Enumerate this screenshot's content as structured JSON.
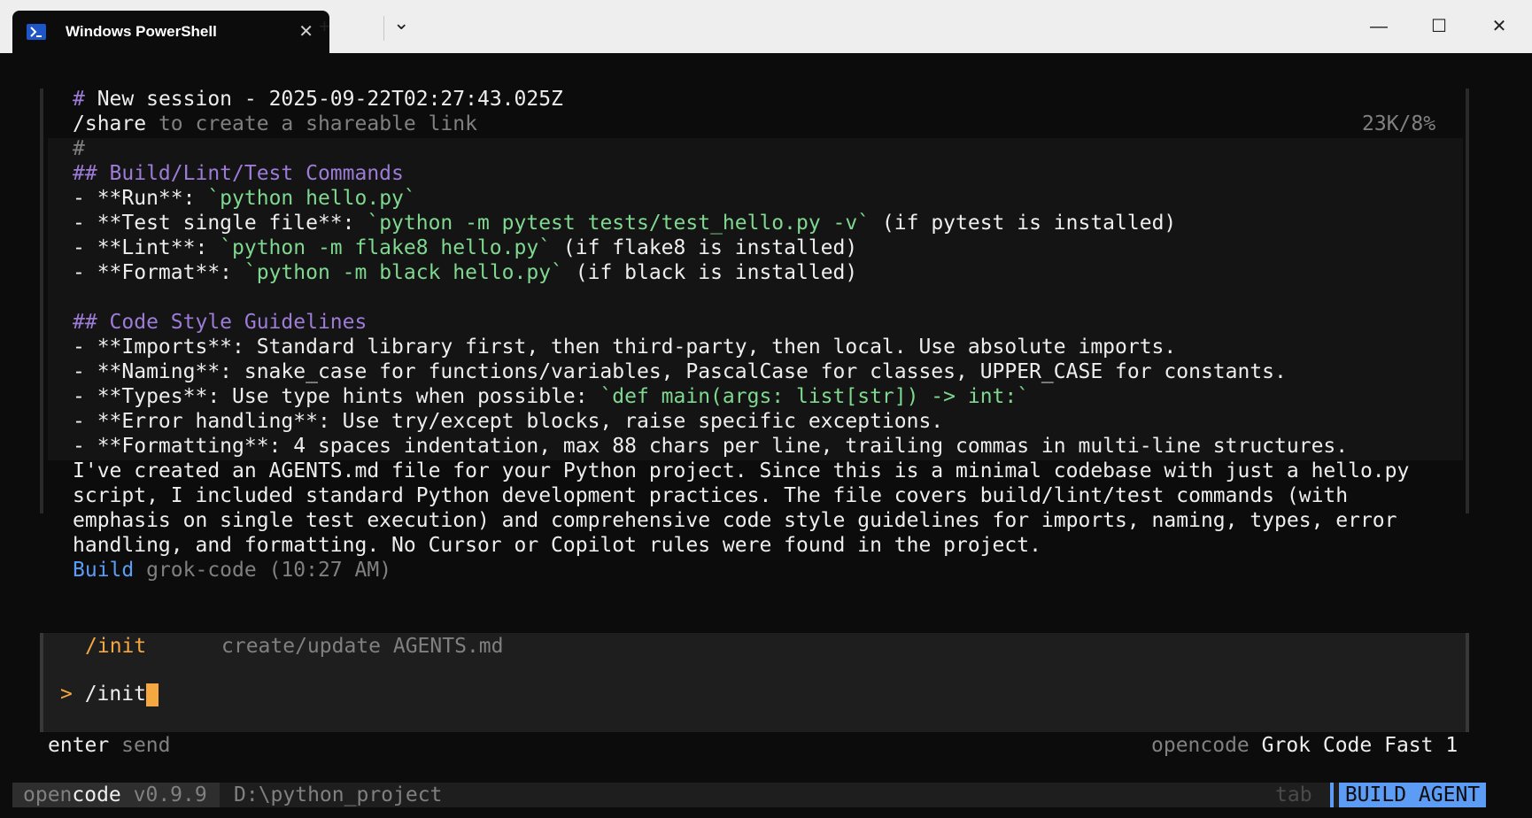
{
  "window": {
    "tab_title": "Windows PowerShell",
    "close_glyph": "✕",
    "new_tab_glyph": "+",
    "dropdown_glyph": "⌄",
    "minimize_glyph": "—",
    "maximize_glyph": "☐",
    "close_window_glyph": "✕"
  },
  "header": {
    "hash": "#",
    "title": " New session - 2025-09-22T02:27:43.025Z",
    "share_cmd": "/share",
    "share_hint": " to create a shareable link",
    "context_usage": "23K/8%"
  },
  "file_content": {
    "line0": "#",
    "line1": "## Build/Lint/Test Commands",
    "line2": [
      "- **Run**: ",
      "`python hello.py`",
      ""
    ],
    "line3": [
      "- **Test single file**: ",
      "`python -m pytest tests/test_hello.py -v`",
      " (if pytest is installed)"
    ],
    "line4": [
      "- **Lint**: ",
      "`python -m flake8 hello.py`",
      " (if flake8 is installed)"
    ],
    "line5": [
      "- **Format**: ",
      "`python -m black hello.py`",
      " (if black is installed)"
    ],
    "line6": "## Code Style Guidelines",
    "line7": "- **Imports**: Standard library first, then third-party, then local. Use absolute imports.",
    "line8": "- **Naming**: snake_case for functions/variables, PascalCase for classes, UPPER_CASE for constants.",
    "line9": [
      "- **Types**: Use type hints when possible: ",
      "`def main(args: list[str]) -> int:`"
    ],
    "line10": "- **Error handling**: Use try/except blocks, raise specific exceptions.",
    "line11": "- **Formatting**: 4 spaces indentation, max 88 chars per line, trailing commas in multi-line structures."
  },
  "response": {
    "lines": [
      "I've created an AGENTS.md file for your Python project. Since this is a minimal codebase with just a hello.py",
      "script, I included standard Python development practices. The file covers build/lint/test commands (with",
      "emphasis on single test execution) and comprehensive code style guidelines for imports, naming, types, error",
      "handling, and formatting. No Cursor or Copilot rules were found in the project."
    ],
    "agent": "Build",
    "model_time": " grok-code (10:27 AM)"
  },
  "input": {
    "suggestion_cmd": "/init",
    "suggestion_desc": "create/update AGENTS.md",
    "prompt": "> ",
    "value": "/init"
  },
  "footer": {
    "enter_key": "enter",
    "enter_action": " send",
    "provider": "opencode",
    "model": " Grok Code Fast 1"
  },
  "status": {
    "brand_a": "open",
    "brand_b": "code",
    "version": " v0.9.9",
    "cwd": "D:\\python_project",
    "tab_hint": "tab",
    "mode": "BUILD AGENT"
  },
  "colors": {
    "accent_purple": "#9d7cd8",
    "code_green": "#7fd88f",
    "agent_blue": "#5c9cf5",
    "cursor_orange": "#f5a742"
  }
}
